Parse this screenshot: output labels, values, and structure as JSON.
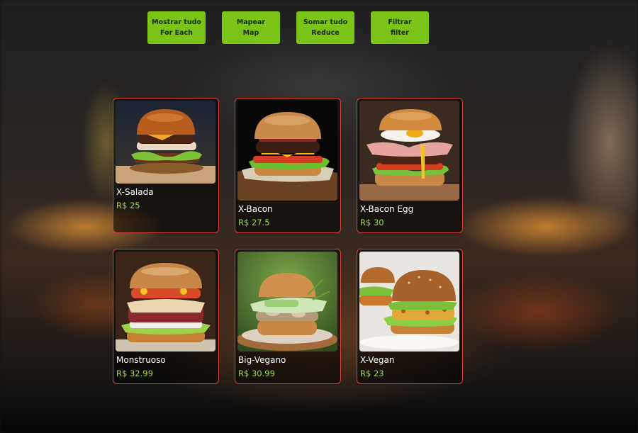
{
  "buttons": [
    {
      "line1": "Mostrar tudo",
      "line2": "For Each"
    },
    {
      "line1": "Mapear",
      "line2": "Map"
    },
    {
      "line1": "Somar tudo",
      "line2": "Reduce"
    },
    {
      "line1": "Filtrar",
      "line2": "filter"
    }
  ],
  "products": [
    {
      "name": "X-Salada",
      "price": "R$ 25",
      "image_icon": "burger-lettuce-photo"
    },
    {
      "name": "X-Bacon",
      "price": "R$ 27.5",
      "image_icon": "burger-bacon-photo"
    },
    {
      "name": "X-Bacon Egg",
      "price": "R$ 30",
      "image_icon": "burger-bacon-egg-photo"
    },
    {
      "name": "Monstruoso",
      "price": "R$ 32.99",
      "image_icon": "burger-monster-photo"
    },
    {
      "name": "Big-Vegano",
      "price": "R$ 30.99",
      "image_icon": "burger-vegan-photo"
    },
    {
      "name": "X-Vegan",
      "price": "R$ 23",
      "image_icon": "burger-x-vegan-photo"
    }
  ],
  "colors": {
    "button_bg": "#79c416",
    "card_border": "#d9423e",
    "price_text": "#9be03a"
  }
}
